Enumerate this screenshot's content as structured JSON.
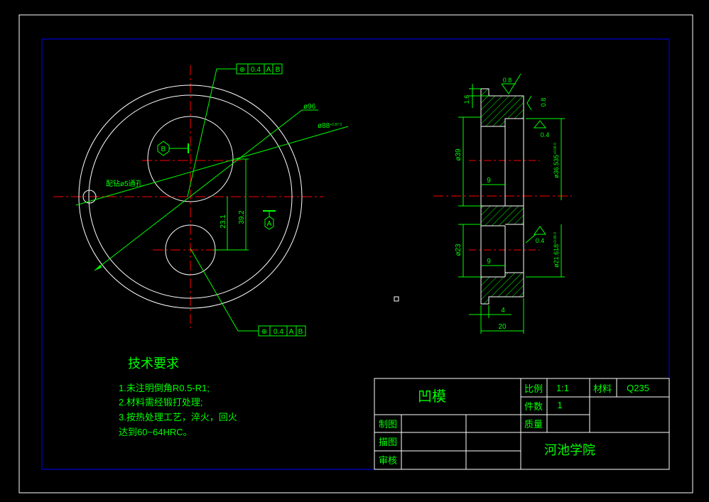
{
  "colors": {
    "background": "#000000",
    "frame": "#ffffff",
    "inner_frame": "#0000ff",
    "part_outline": "#ffffff",
    "dimension": "#00ff00",
    "centerline": "#ff0000",
    "hatch": "#00ff00",
    "title_text": "#00ff00",
    "title_lines": "#ffffff"
  },
  "front_view": {
    "datum_b": "B",
    "datum_a": "A",
    "gdt_top": {
      "symbol": "⊕",
      "tolerance": "0.4",
      "datum1": "A",
      "datum2": "B"
    },
    "gdt_bottom": {
      "symbol": "⊕",
      "tolerance": "0.4",
      "datum1": "A",
      "datum2": "B"
    },
    "dim_outer": "ø96",
    "dim_bolt": "ø88",
    "dim_bolt_tol": "+0.87 0",
    "dim_distance_1": "23.1",
    "dim_distance_2": "39.2",
    "hole_note": "配钻ø5通孔"
  },
  "section_view": {
    "roughness_top": "0.8",
    "roughness_right": "0.8",
    "roughness_mid": "0.4",
    "roughness_low": "0.4",
    "dim_step": "1.6",
    "dim_outer_dia": "ø39",
    "dim_upper_bore": "ø36.535",
    "dim_upper_bore_tol": "+0.06 0",
    "dim_upper_depth": "9",
    "dim_lower_dia": "ø23",
    "dim_lower_bore": "ø21.618",
    "dim_lower_bore_tol": "+0.06 0",
    "dim_lower_depth": "9",
    "dim_flange": "4",
    "dim_width": "20"
  },
  "tech_requirements": {
    "title": "技术要求",
    "items": [
      "1.未注明倒角R0.5-R1;",
      "2.材料需经锻打处理;",
      "3.按热处理工艺，淬火，回火",
      "达到60~64HRC。"
    ]
  },
  "title_block": {
    "part_name": "凹模",
    "scale_label": "比例",
    "scale_value": "1:1",
    "material_label": "材料",
    "material_value": "Q235",
    "quantity_label": "件数",
    "quantity_value": "1",
    "mass_label": "质量",
    "drawn_label": "制图",
    "traced_label": "描图",
    "checked_label": "审核",
    "school": "河池学院"
  }
}
